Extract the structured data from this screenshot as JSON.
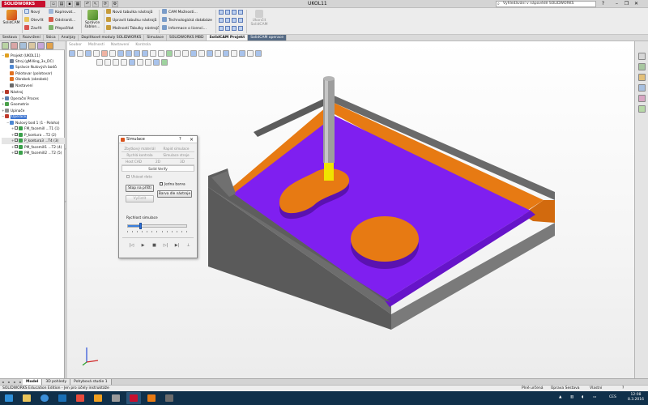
{
  "window": {
    "app_logo": "SOLIDWORKS",
    "title": "UKOL11",
    "search_placeholder": "Vyhledávání v nápovědě SOLIDWORKS",
    "controls": [
      "minimize",
      "restore",
      "close"
    ]
  },
  "ribbon": {
    "solidcam_label": "SolidCAM",
    "solidcam_sublabel": "SolidCAM",
    "col1": [
      "Nový",
      "Otevřít",
      "Zavřít"
    ],
    "col2": [
      "Kopírovat...",
      "Odstranit...",
      "Přepočítat"
    ],
    "manager_label_1": "Správce",
    "manager_label_2": "šablon...",
    "col3": [
      "Nová tabulka nástrojů",
      "Upravit tabulku nástrojů",
      "Možnosti Tabulky nástrojů"
    ],
    "col4": [
      "CAM Možnosti...",
      "Technologická databáze",
      "Informace o licenci..."
    ],
    "exit_label_1": "Ukončit",
    "exit_label_2": "SolidCAM"
  },
  "tabs": [
    "Sestava",
    "Rozvržení",
    "Skica",
    "Analýzy",
    "Doplňkové moduly SOLIDWORKS",
    "Simulace",
    "SOLIDWORKS MBD",
    "SolidCAM Projekt",
    "SolidCAM operace"
  ],
  "tabs_active_index": 7,
  "tree": [
    {
      "label": "Projekt (UKOL11)",
      "level": 0,
      "color": "#e0a020",
      "exp": "−"
    },
    {
      "label": "Stroj (gMilling_3x_DC)",
      "level": 1,
      "color": "#6d7e96"
    },
    {
      "label": "Správce Nulových bodů",
      "level": 1,
      "color": "#4d88d4"
    },
    {
      "label": "Polotovar (polotovar)",
      "level": 1,
      "color": "#e07020"
    },
    {
      "label": "Obrobek (obrobek)",
      "level": 1,
      "color": "#e07020"
    },
    {
      "label": "Nastavení",
      "level": 1,
      "color": "#6a6a6a"
    },
    {
      "label": "Nástroj",
      "level": 0,
      "color": "#b53a2a",
      "exp": "+"
    },
    {
      "label": "Operační Proces",
      "level": 0,
      "color": "#5a7fb0",
      "exp": "+"
    },
    {
      "label": "Geometrie",
      "level": 0,
      "color": "#4aa04a",
      "exp": "+"
    },
    {
      "label": "Upínače",
      "level": 0,
      "color": "#8a8a8a",
      "exp": "+"
    },
    {
      "label": "Operace",
      "level": 0,
      "color": "#c0392b",
      "exp": "−",
      "selected": true
    },
    {
      "label": "Nulový bod 1 (1 - Poloha)",
      "level": 1,
      "color": "#4d88d4",
      "exp": "−"
    },
    {
      "label": "FM_facemill ...T1 (1)",
      "level": 2,
      "color": "#3aa04a",
      "cb": true,
      "exp": "+"
    },
    {
      "label": "P_kontura ...T2 (2)",
      "level": 2,
      "color": "#3aa04a",
      "cb": true,
      "exp": "+"
    },
    {
      "label": "P_kontura3 ...T4 (3)",
      "level": 2,
      "color": "#3aa04a",
      "cb": true,
      "exp": "+",
      "highlight": true
    },
    {
      "label": "PM_facemill1 ...T2 (4)",
      "level": 2,
      "color": "#3aa04a",
      "cb": true,
      "exp": "+"
    },
    {
      "label": "PM_facemill2 ...T2 (5)",
      "level": 2,
      "color": "#3aa04a",
      "cb": true,
      "exp": "+"
    }
  ],
  "viewport_menu": [
    "Soubor",
    "Možnosti",
    "Nastavení",
    "Kontrola"
  ],
  "dialog": {
    "title": "Simulace",
    "help": "?",
    "close": "×",
    "tab_rows": [
      [
        {
          "label": "Zbytkový materiál",
          "active": false
        },
        {
          "label": "Rapid simulace",
          "active": false
        }
      ],
      [
        {
          "label": "Rychlá kontrola",
          "active": false
        },
        {
          "label": "Simulace stroje",
          "active": false
        }
      ],
      [
        {
          "label": "Host CAD",
          "active": false
        },
        {
          "label": "2D",
          "active": false
        },
        {
          "label": "3D",
          "active": false
        }
      ],
      [
        {
          "label": "Solid Verify",
          "active": true
        }
      ]
    ],
    "show_data": "Ukázat data",
    "stop_button": "Stop na příští",
    "reset_button": "Vyčistit",
    "one_color": "Jedna barva",
    "color_by_tool": "Barva dle nástroje",
    "speed_label": "Rychlost simulace",
    "speed_value": 0.2,
    "playback": [
      "|◁",
      "▶",
      "■",
      "▷|",
      "▶|",
      "⊥"
    ]
  },
  "bottom_tabs": [
    "Model",
    "3D pohledy",
    "Pohybová studie 1"
  ],
  "bottom_active_index": 0,
  "status": {
    "left": "SOLIDWORKS Education Edition - Jen pro účely instruktáže",
    "mid1": "Plně určená",
    "mid2": "Úprava Sestava",
    "right": "Vlastní"
  },
  "taskbar": {
    "lang": "CES",
    "time": "12:08",
    "date": "8.3.2016"
  },
  "colors": {
    "purple": "#7f1ff0",
    "orange": "#e77a13",
    "steel": "#5f5f5f",
    "selection": "#3c74d0"
  }
}
